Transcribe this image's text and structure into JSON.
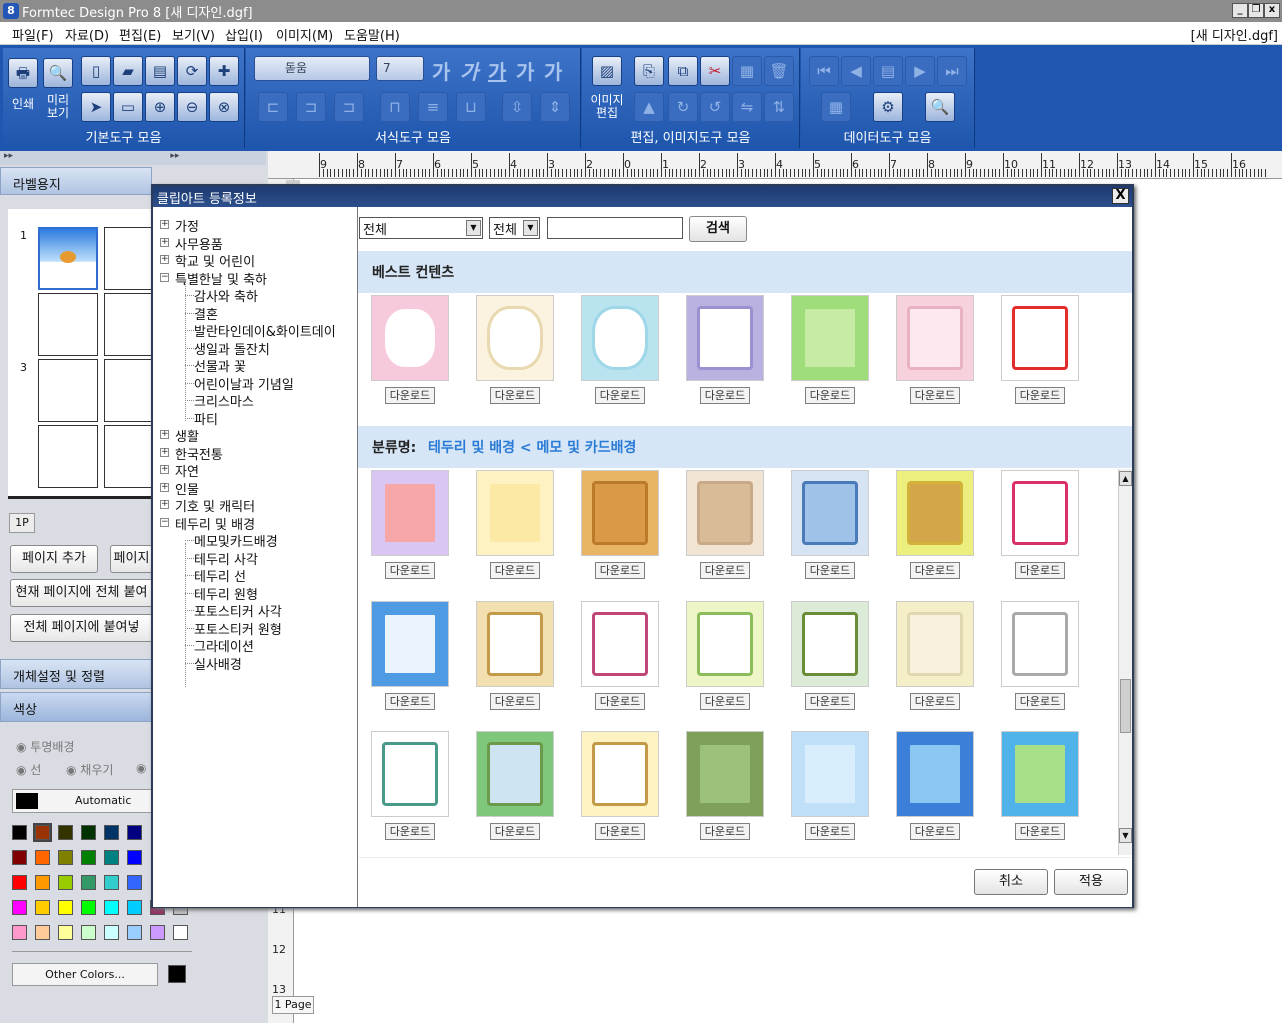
{
  "window": {
    "title": "Formtec Design Pro 8 [새 디자인.dgf]",
    "doc_label": "[새 디자인.dgf]"
  },
  "menu": [
    "파일(F)",
    "자료(D)",
    "편집(E)",
    "보기(V)",
    "삽입(I)",
    "이미지(M)",
    "도움말(H)"
  ],
  "toolbar": {
    "print_label": "인쇄",
    "preview_label": "미리 보기",
    "image_edit_label": "이미지 편집",
    "font_name": "돋움",
    "font_size": "7",
    "groups": [
      "기본도구 모음",
      "서식도구 모음",
      "편집, 이미지도구 모음",
      "데이터도구 모음"
    ]
  },
  "left": {
    "header": "라벨용지",
    "rows": [
      "1",
      "3"
    ],
    "page_tab": "1P",
    "btn_add_page": "페이지 추가",
    "btn_page2": "페이지",
    "btn_paste_current": "현재 페이지에 전체 붙여",
    "btn_paste_all": "전체 페이지에 붙여넣",
    "section_objects": "개체설정 및 정렬",
    "section_color": "색상",
    "opt_transparent": "투명배경",
    "opt_line": "선",
    "opt_fill": "채우기",
    "color_auto": "Automatic",
    "other_colors": "Other Colors..."
  },
  "colors": {
    "accent": "#1e56b0",
    "palette": [
      [
        "#000000",
        "#993300",
        "#333300",
        "#003300",
        "#003366",
        "#000080",
        "#333399",
        "#333333"
      ],
      [
        "#800000",
        "#ff6600",
        "#808000",
        "#008000",
        "#008080",
        "#0000ff",
        "#666699",
        "#808080"
      ],
      [
        "#ff0000",
        "#ff9900",
        "#99cc00",
        "#339966",
        "#33cccc",
        "#3366ff",
        "#800080",
        "#969696"
      ],
      [
        "#ff00ff",
        "#ffcc00",
        "#ffff00",
        "#00ff00",
        "#00ffff",
        "#00ccff",
        "#993366",
        "#c0c0c0"
      ],
      [
        "#ff99cc",
        "#ffcc99",
        "#ffff99",
        "#ccffcc",
        "#ccffff",
        "#99ccff",
        "#cc99ff",
        "#ffffff"
      ]
    ]
  },
  "ruler": {
    "h": [
      "9",
      "8",
      "7",
      "6",
      "5",
      "4",
      "3",
      "2",
      "0",
      "1",
      "2",
      "3",
      "4",
      "5",
      "6",
      "7",
      "8",
      "9",
      "10",
      "11",
      "12",
      "13",
      "14",
      "15",
      "16"
    ],
    "v": [
      "11",
      "12",
      "13"
    ],
    "page_label": "1 Page"
  },
  "dialog": {
    "title": "클립아트 등록정보",
    "close": "X",
    "tree": [
      {
        "label": "가정",
        "level": 0,
        "toggle": "+"
      },
      {
        "label": "사무용품",
        "level": 0,
        "toggle": "+"
      },
      {
        "label": "학교 및 어린이",
        "level": 0,
        "toggle": "+"
      },
      {
        "label": "특별한날 및 축하",
        "level": 0,
        "toggle": "-"
      },
      {
        "label": "감사와 축하",
        "level": 1
      },
      {
        "label": "결혼",
        "level": 1
      },
      {
        "label": "발란타인데이&화이트데이",
        "level": 1
      },
      {
        "label": "생일과 돌잔치",
        "level": 1
      },
      {
        "label": "선물과 꽃",
        "level": 1
      },
      {
        "label": "어린이날과 기념일",
        "level": 1
      },
      {
        "label": "크리스마스",
        "level": 1
      },
      {
        "label": "파티",
        "level": 1
      },
      {
        "label": "생활",
        "level": 0,
        "toggle": "+"
      },
      {
        "label": "한국전통",
        "level": 0,
        "toggle": "+"
      },
      {
        "label": "자연",
        "level": 0,
        "toggle": "+"
      },
      {
        "label": "인물",
        "level": 0,
        "toggle": "+"
      },
      {
        "label": "기호 및 캐릭터",
        "level": 0,
        "toggle": "+"
      },
      {
        "label": "테두리 및 배경",
        "level": 0,
        "toggle": "-"
      },
      {
        "label": "메모및카드배경",
        "level": 1
      },
      {
        "label": "테두리 사각",
        "level": 1
      },
      {
        "label": "테두리 선",
        "level": 1
      },
      {
        "label": "테두리 원형",
        "level": 1
      },
      {
        "label": "포토스티커 사각",
        "level": 1
      },
      {
        "label": "포토스티커 원형",
        "level": 1
      },
      {
        "label": "그라데이션",
        "level": 1
      },
      {
        "label": "실사배경",
        "level": 1
      }
    ],
    "filter1": "전체",
    "filter2": "전체",
    "search_value": "",
    "search_btn": "검색",
    "best_title": "베스트 컨텐츠",
    "category_prefix": "분류명:",
    "category_path": "테두리 및 배경 < 메모 및 카드배경",
    "download": "다운로드",
    "cancel": "취소",
    "apply": "적용"
  }
}
